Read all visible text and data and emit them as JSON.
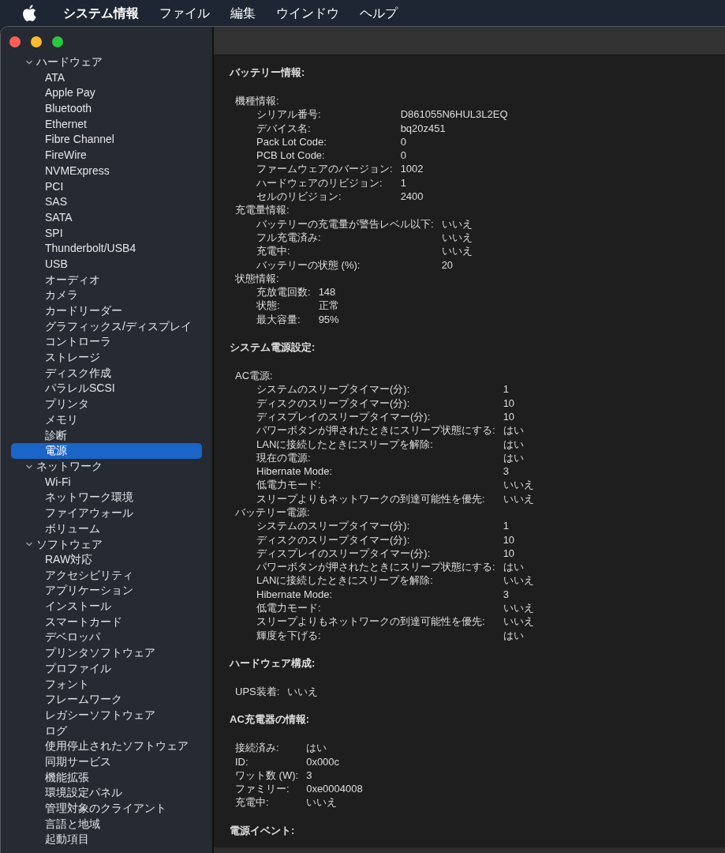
{
  "menu_bar": {
    "app_name": "システム情報",
    "items": [
      "ファイル",
      "編集",
      "ウインドウ",
      "ヘルプ"
    ]
  },
  "sidebar": [
    {
      "label": "ハードウェア",
      "expanded": true,
      "selected": false,
      "children": [
        {
          "label": "ATA",
          "selected": false
        },
        {
          "label": "Apple Pay",
          "selected": false
        },
        {
          "label": "Bluetooth",
          "selected": false
        },
        {
          "label": "Ethernet",
          "selected": false
        },
        {
          "label": "Fibre Channel",
          "selected": false
        },
        {
          "label": "FireWire",
          "selected": false
        },
        {
          "label": "NVMExpress",
          "selected": false
        },
        {
          "label": "PCI",
          "selected": false
        },
        {
          "label": "SAS",
          "selected": false
        },
        {
          "label": "SATA",
          "selected": false
        },
        {
          "label": "SPI",
          "selected": false
        },
        {
          "label": "Thunderbolt/USB4",
          "selected": false
        },
        {
          "label": "USB",
          "selected": false
        },
        {
          "label": "オーディオ",
          "selected": false
        },
        {
          "label": "カメラ",
          "selected": false
        },
        {
          "label": "カードリーダー",
          "selected": false
        },
        {
          "label": "グラフィックス/ディスプレイ",
          "selected": false
        },
        {
          "label": "コントローラ",
          "selected": false
        },
        {
          "label": "ストレージ",
          "selected": false
        },
        {
          "label": "ディスク作成",
          "selected": false
        },
        {
          "label": "パラレルSCSI",
          "selected": false
        },
        {
          "label": "プリンタ",
          "selected": false
        },
        {
          "label": "メモリ",
          "selected": false
        },
        {
          "label": "診断",
          "selected": false
        },
        {
          "label": "電源",
          "selected": true
        }
      ]
    },
    {
      "label": "ネットワーク",
      "expanded": true,
      "selected": false,
      "children": [
        {
          "label": "Wi-Fi",
          "selected": false
        },
        {
          "label": "ネットワーク環境",
          "selected": false
        },
        {
          "label": "ファイアウォール",
          "selected": false
        },
        {
          "label": "ボリューム",
          "selected": false
        }
      ]
    },
    {
      "label": "ソフトウェア",
      "expanded": true,
      "selected": false,
      "children": [
        {
          "label": "RAW対応",
          "selected": false
        },
        {
          "label": "アクセシビリティ",
          "selected": false
        },
        {
          "label": "アプリケーション",
          "selected": false
        },
        {
          "label": "インストール",
          "selected": false
        },
        {
          "label": "スマートカード",
          "selected": false
        },
        {
          "label": "デベロッパ",
          "selected": false
        },
        {
          "label": "プリンタソフトウェア",
          "selected": false
        },
        {
          "label": "プロファイル",
          "selected": false
        },
        {
          "label": "フォント",
          "selected": false
        },
        {
          "label": "フレームワーク",
          "selected": false
        },
        {
          "label": "レガシーソフトウェア",
          "selected": false
        },
        {
          "label": "ログ",
          "selected": false
        },
        {
          "label": "使用停止されたソフトウェア",
          "selected": false
        },
        {
          "label": "同期サービス",
          "selected": false
        },
        {
          "label": "機能拡張",
          "selected": false
        },
        {
          "label": "環境設定パネル",
          "selected": false
        },
        {
          "label": "管理対象のクライアント",
          "selected": false
        },
        {
          "label": "言語と地域",
          "selected": false
        },
        {
          "label": "起動項目",
          "selected": false
        }
      ]
    }
  ],
  "sections": [
    {
      "title": "バッテリー情報:",
      "groups": [
        {
          "title": "機種情報:",
          "rows": [
            {
              "label": "シリアル番号:",
              "value": "D861055N6HUL3L2EQ"
            },
            {
              "label": "デバイス名:",
              "value": "bq20z451"
            },
            {
              "label": "Pack Lot Code:",
              "value": "0"
            },
            {
              "label": "PCB Lot Code:",
              "value": "0"
            },
            {
              "label": "ファームウェアのバージョン:",
              "value": "1002"
            },
            {
              "label": "ハードウェアのリビジョン:",
              "value": "1"
            },
            {
              "label": "セルのリビジョン:",
              "value": "2400"
            }
          ]
        },
        {
          "title": "充電量情報:",
          "rows": [
            {
              "label": "バッテリーの充電量が警告レベル以下:",
              "value": "いいえ"
            },
            {
              "label": "フル充電済み:",
              "value": "いいえ"
            },
            {
              "label": "充電中:",
              "value": "いいえ"
            },
            {
              "label": "バッテリーの状態 (%):",
              "value": "20"
            }
          ]
        },
        {
          "title": "状態情報:",
          "rows": [
            {
              "label": "充放電回数:",
              "value": "148"
            },
            {
              "label": "状態:",
              "value": "正常"
            },
            {
              "label": "最大容量:",
              "value": "95%"
            }
          ]
        }
      ]
    },
    {
      "title": "システム電源設定:",
      "groups": [
        {
          "title": "AC電源:",
          "rows": [
            {
              "label": "システムのスリープタイマー(分):",
              "value": "1"
            },
            {
              "label": "ディスクのスリープタイマー(分):",
              "value": "10"
            },
            {
              "label": "ディスプレイのスリープタイマー(分):",
              "value": "10"
            },
            {
              "label": "パワーボタンが押されたときにスリープ状態にする:",
              "value": "はい"
            },
            {
              "label": "LANに接続したときにスリープを解除:",
              "value": "はい"
            },
            {
              "label": "現在の電源:",
              "value": "はい"
            },
            {
              "label": "Hibernate Mode:",
              "value": "3"
            },
            {
              "label": "低電力モード:",
              "value": "いいえ"
            },
            {
              "label": "スリープよりもネットワークの到達可能性を優先:",
              "value": "いいえ"
            }
          ]
        },
        {
          "title": "バッテリー電源:",
          "rows": [
            {
              "label": "システムのスリープタイマー(分):",
              "value": "1"
            },
            {
              "label": "ディスクのスリープタイマー(分):",
              "value": "10"
            },
            {
              "label": "ディスプレイのスリープタイマー(分):",
              "value": "10"
            },
            {
              "label": "パワーボタンが押されたときにスリープ状態にする:",
              "value": "はい"
            },
            {
              "label": "LANに接続したときにスリープを解除:",
              "value": "いいえ"
            },
            {
              "label": "Hibernate Mode:",
              "value": "3"
            },
            {
              "label": "低電力モード:",
              "value": "いいえ"
            },
            {
              "label": "スリープよりもネットワークの到達可能性を優先:",
              "value": "いいえ"
            },
            {
              "label": "輝度を下げる:",
              "value": "はい"
            }
          ]
        }
      ]
    },
    {
      "title": "ハードウェア構成:",
      "groups": [
        {
          "rows": [
            {
              "label": "UPS装着:",
              "value": "いいえ"
            }
          ]
        }
      ]
    },
    {
      "title": "AC充電器の情報:",
      "groups": [
        {
          "rows": [
            {
              "label": "接続済み:",
              "value": "はい"
            },
            {
              "label": "ID:",
              "value": "0x000c"
            },
            {
              "label": "ワット数 (W):",
              "value": "3"
            },
            {
              "label": "ファミリー:",
              "value": "0xe0004008"
            },
            {
              "label": "充電中:",
              "value": "いいえ"
            }
          ]
        }
      ]
    },
    {
      "title": "電源イベント:"
    }
  ]
}
